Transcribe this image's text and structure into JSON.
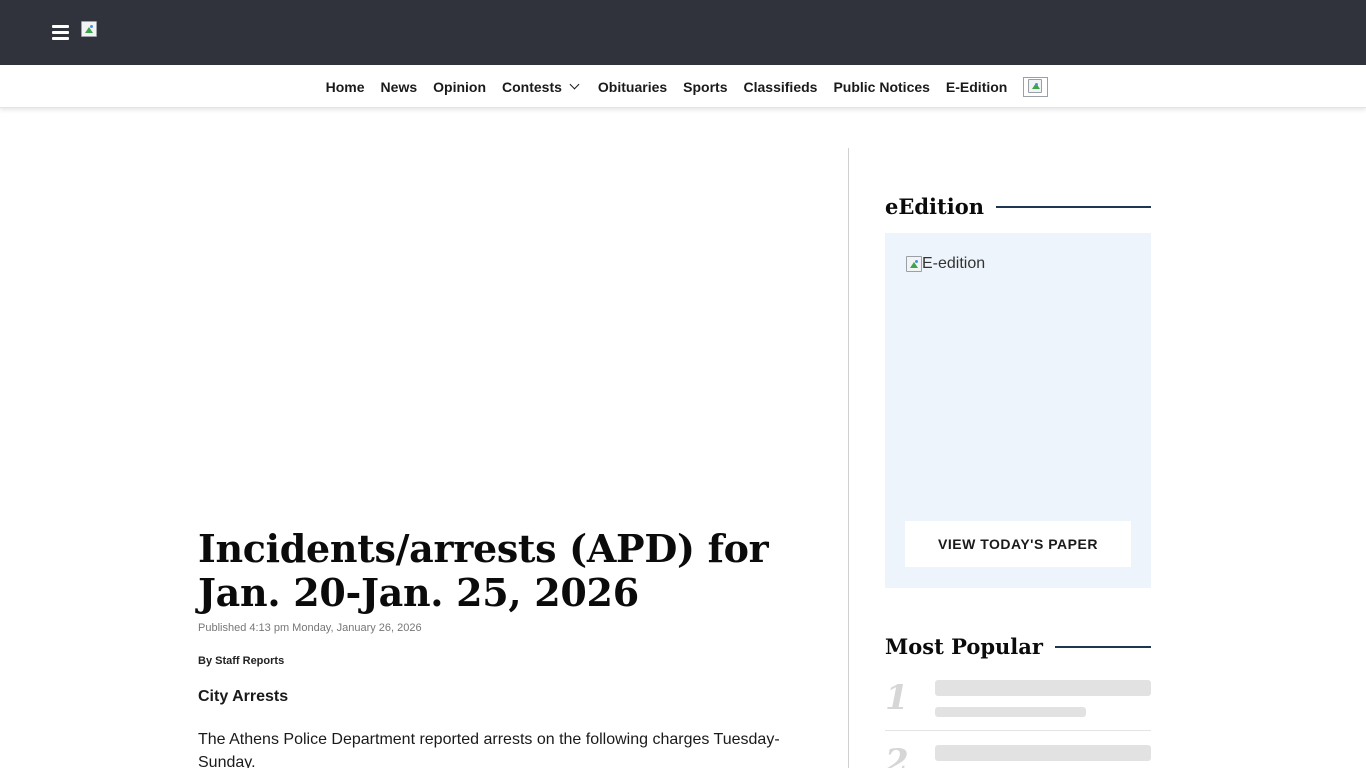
{
  "header": {
    "menu_icon": "hamburger-menu-icon",
    "logo_alt": ""
  },
  "nav": {
    "items": [
      {
        "label": "Home"
      },
      {
        "label": "News"
      },
      {
        "label": "Opinion"
      },
      {
        "label": "Contests",
        "has_dropdown": true
      },
      {
        "label": "Obituaries"
      },
      {
        "label": "Sports"
      },
      {
        "label": "Classifieds"
      },
      {
        "label": "Public Notices"
      },
      {
        "label": "E-Edition"
      }
    ]
  },
  "article": {
    "title": "Incidents/arrests (APD) for Jan. 20-Jan. 25, 2026",
    "published": "Published 4:13 pm Monday, January 26, 2026",
    "byline_prefix": "By",
    "author": "Staff Reports",
    "section_heading": "City Arrests",
    "paragraph": "The Athens Police Department reported arrests on the following charges Tuesday-Sunday."
  },
  "sidebar": {
    "edition": {
      "heading": "eEdition",
      "image_alt": "E-edition",
      "button_label": "VIEW TODAY'S PAPER"
    },
    "popular": {
      "heading": "Most Popular",
      "items": [
        {
          "rank": "1"
        },
        {
          "rank": "2"
        }
      ]
    }
  },
  "colors": {
    "topbar": "#30333c",
    "accent_line": "#1e3650",
    "edition_bg": "#eef4fb",
    "skeleton": "#e2e2e2"
  }
}
